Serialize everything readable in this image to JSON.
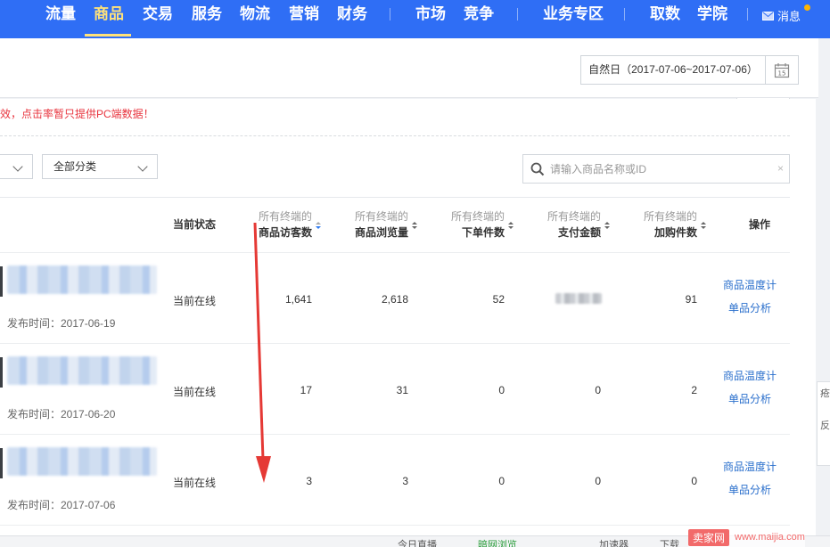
{
  "nav": {
    "items": [
      "流量",
      "商品",
      "交易",
      "服务",
      "物流",
      "营销",
      "财务",
      "市场",
      "竞争",
      "业务专区",
      "取数",
      "学院"
    ],
    "active": "商品",
    "message_label": "消息"
  },
  "toolbar": {
    "date_range": "自然日（2017-07-06~2017-07-06）",
    "calendar_day": "15"
  },
  "notice": "效，点击率暂只提供PC端数据！",
  "filters": {
    "category_selected": "全部分类",
    "search_placeholder": "请输入商品名称或ID",
    "search_value": ""
  },
  "table": {
    "col_status": "当前状态",
    "col_visitors_l1": "所有终端的",
    "col_visitors_l2": "商品访客数",
    "col_views_l1": "所有终端的",
    "col_views_l2": "商品浏览量",
    "col_orders_l1": "所有终端的",
    "col_orders_l2": "下单件数",
    "col_pay_l1": "所有终端的",
    "col_pay_l2": "支付金额",
    "col_cart_l1": "所有终端的",
    "col_cart_l2": "加购件数",
    "col_ops": "操作",
    "rows": [
      {
        "published": "发布时间：2017-06-19",
        "status": "当前在线",
        "visitors": "1,641",
        "views": "2,618",
        "orders": "52",
        "pay": "",
        "cart": "91",
        "op1": "商品温度计",
        "op2": "单品分析"
      },
      {
        "published": "发布时间：2017-06-20",
        "status": "当前在线",
        "visitors": "17",
        "views": "31",
        "orders": "0",
        "pay": "0",
        "cart": "2",
        "op1": "商品温度计",
        "op2": "单品分析"
      },
      {
        "published": "发布时间：2017-07-06",
        "status": "当前在线",
        "visitors": "3",
        "views": "3",
        "orders": "0",
        "pay": "0",
        "cart": "0",
        "op1": "商品温度计",
        "op2": "单品分析"
      }
    ]
  },
  "side_float": [
    "疮",
    "反"
  ],
  "bottom_bar": [
    "今日直播",
    "暗网浏览",
    "加速器",
    "下载"
  ],
  "watermark": {
    "logo": "卖家网",
    "url": "www.maijia.com"
  },
  "colors": {
    "nav_bg": "#2f6ef5",
    "nav_active": "#ffe27a",
    "link": "#2a6fcc",
    "notice": "#e8343e",
    "arrow": "#e53935"
  }
}
